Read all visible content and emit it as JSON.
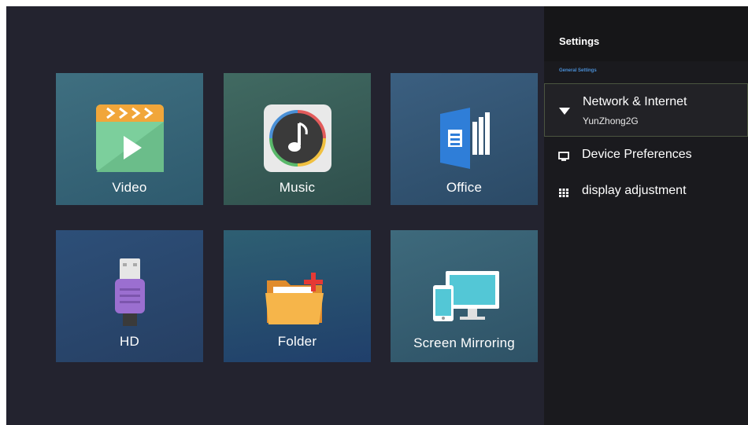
{
  "tiles": [
    {
      "label": "Video",
      "icon": "video-clapper-icon"
    },
    {
      "label": "Music",
      "icon": "music-note-icon"
    },
    {
      "label": "Office",
      "icon": "office-document-icon"
    },
    {
      "label": "HD",
      "icon": "hdmi-icon"
    },
    {
      "label": "Folder",
      "icon": "folder-icon"
    },
    {
      "label": "Screen Mirroring",
      "icon": "screen-mirroring-icon"
    }
  ],
  "settings": {
    "title": "Settings",
    "section_label": "General Settings",
    "items": [
      {
        "label": "Network & Internet",
        "sub": "YunZhong2G",
        "icon": "wifi-icon",
        "selected": true
      },
      {
        "label": "Device Preferences",
        "icon": "monitor-icon"
      },
      {
        "label": "display adjustment",
        "icon": "grid-icon"
      }
    ]
  },
  "colors": {
    "background": "#23232f",
    "panel": "#1a1a1e",
    "accent": "#4a8fd6"
  }
}
